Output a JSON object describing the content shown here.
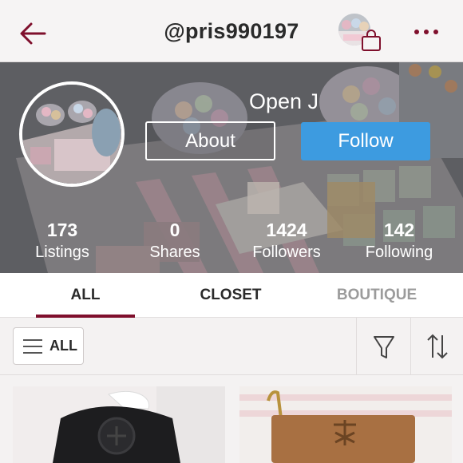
{
  "header": {
    "username": "@pris990197",
    "back_icon": "arrow-left-icon",
    "more_icon": "more-dots-icon",
    "bag_icon": "shopping-bag-icon",
    "accent_color": "#7f0f2c"
  },
  "profile": {
    "display_name": "Open J",
    "about_label": "About",
    "follow_label": "Follow",
    "follow_color": "#3d9be0"
  },
  "stats": [
    {
      "value": "173",
      "label": "Listings"
    },
    {
      "value": "0",
      "label": "Shares"
    },
    {
      "value": "1424",
      "label": "Followers"
    },
    {
      "value": "142",
      "label": "Following"
    }
  ],
  "tabs": [
    {
      "label": "ALL",
      "state": "active"
    },
    {
      "label": "CLOSET",
      "state": "normal"
    },
    {
      "label": "BOUTIQUE",
      "state": "muted"
    }
  ],
  "filters": {
    "all_label": "ALL",
    "menu_icon": "hamburger-icon",
    "filter_icon": "funnel-icon",
    "sort_icon": "sort-arrows-icon"
  }
}
